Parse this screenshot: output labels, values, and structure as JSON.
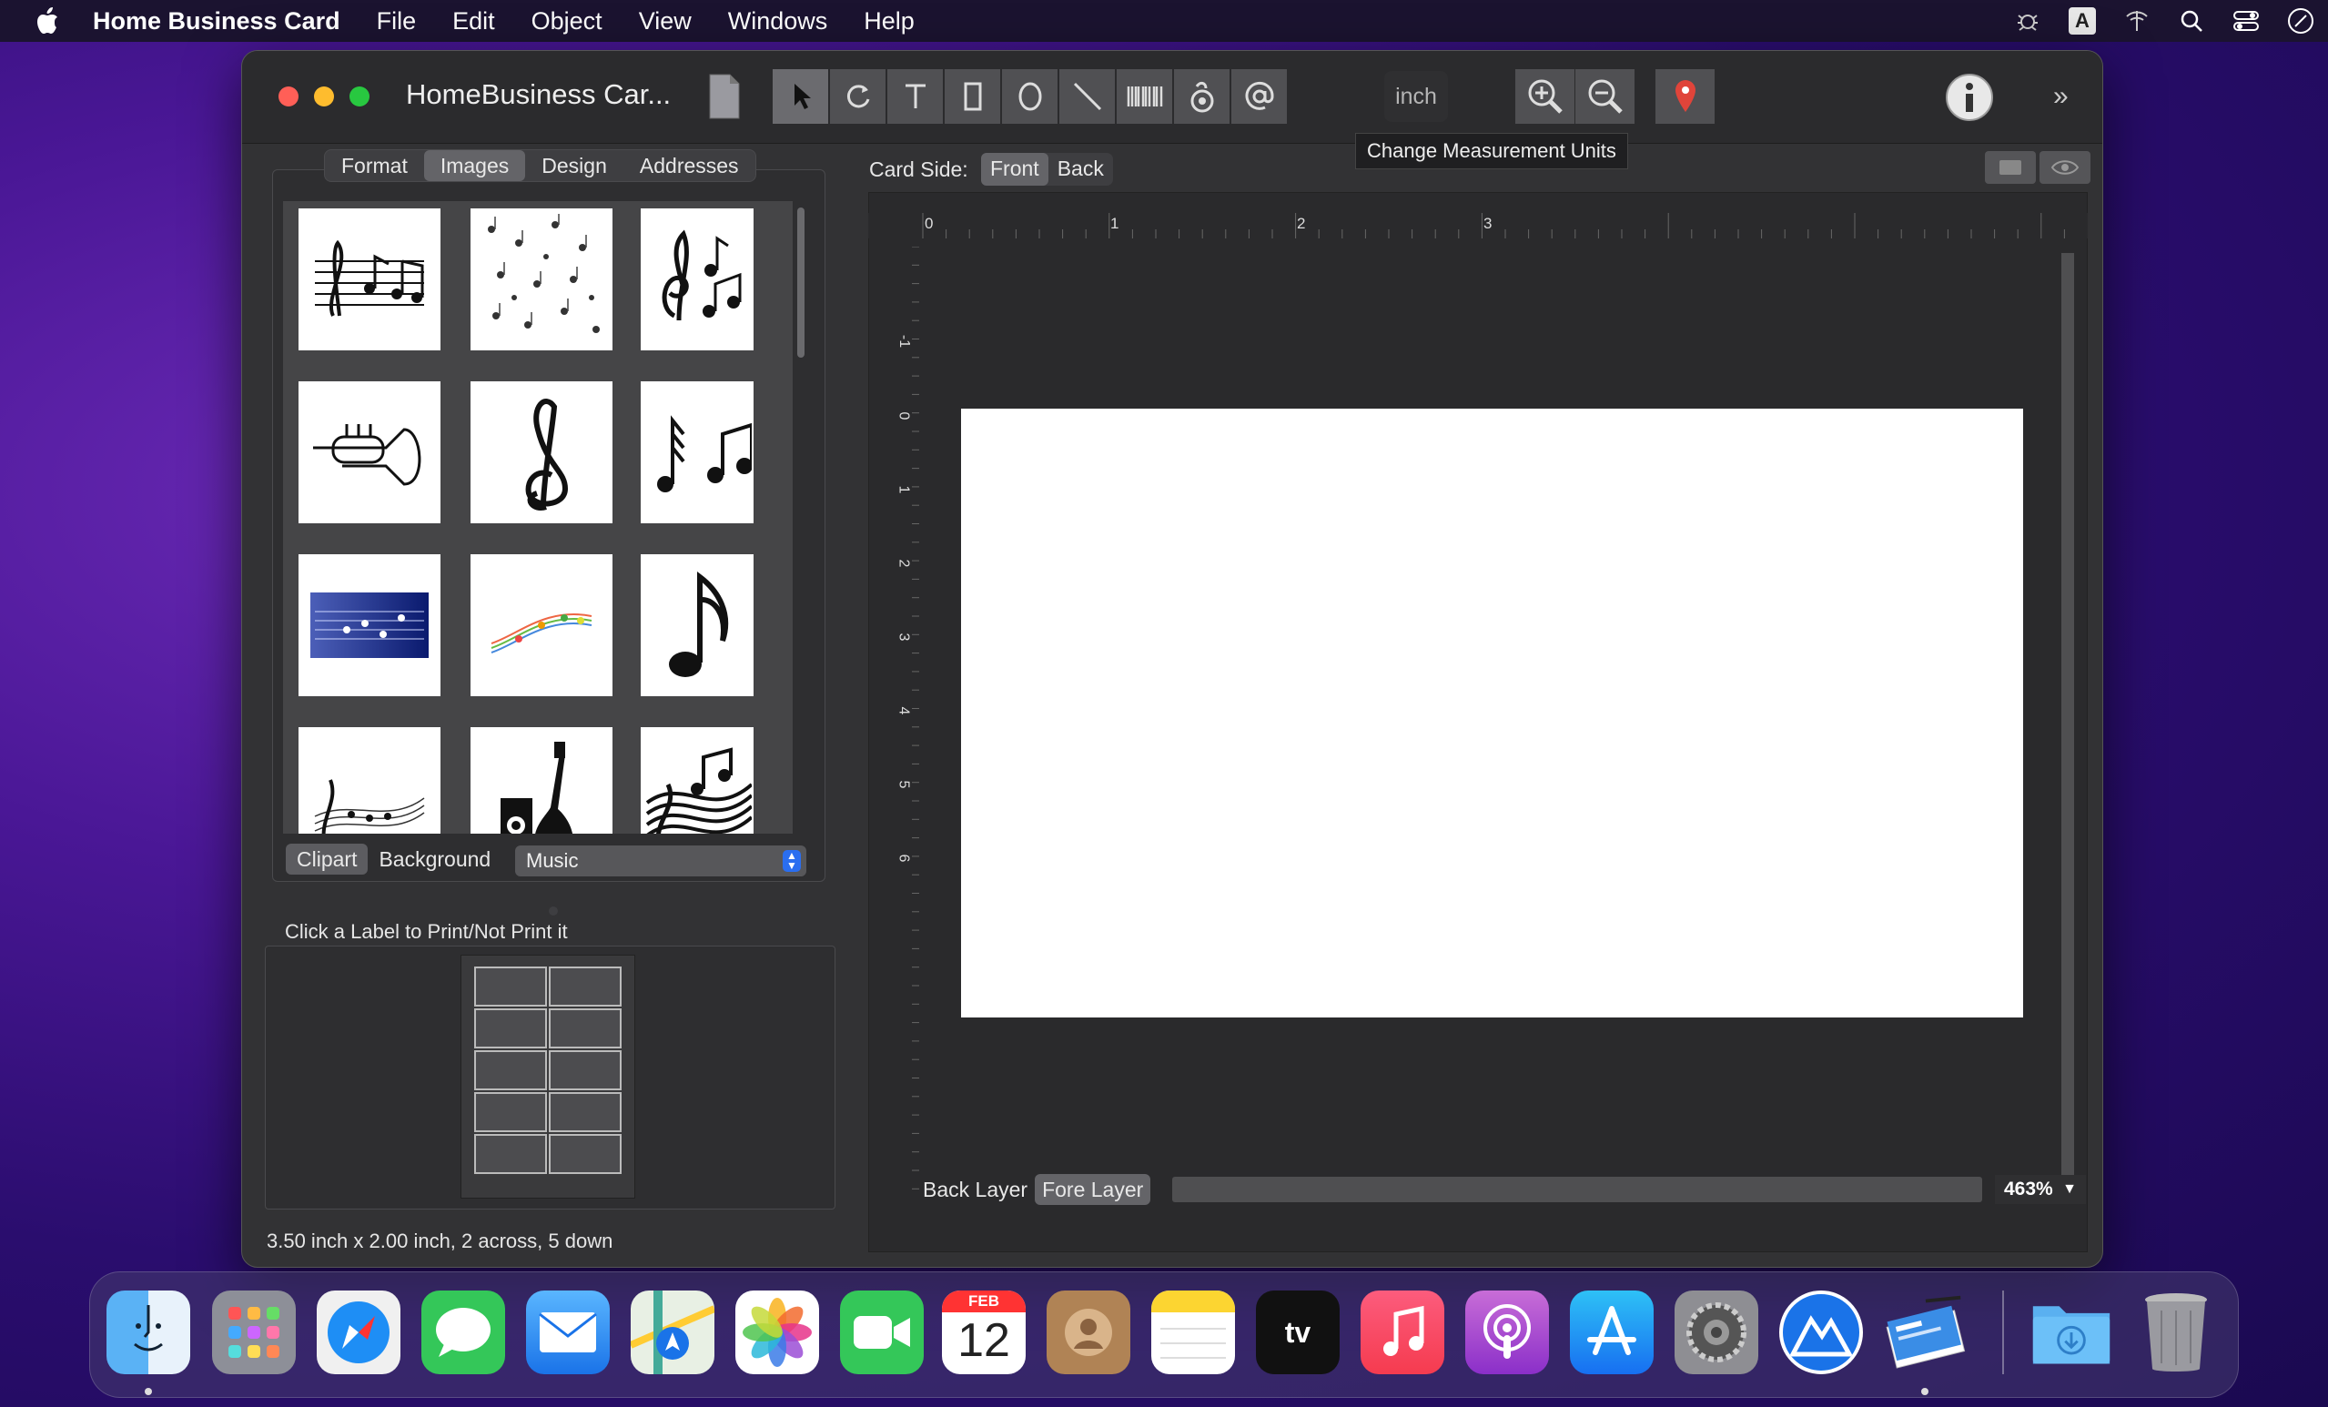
{
  "menubar": {
    "app": "Home Business Card",
    "items": [
      "File",
      "Edit",
      "Object",
      "View",
      "Windows",
      "Help"
    ]
  },
  "window": {
    "title": "HomeBusiness Car...",
    "unit": "inch",
    "tooltip": "Change Measurement Units"
  },
  "left": {
    "tabs": [
      "Format",
      "Images",
      "Design",
      "Addresses"
    ],
    "active_tab": "Images",
    "bottom_tabs": [
      "Clipart",
      "Background"
    ],
    "category": "Music",
    "label_hint": "Click a Label to Print/Not Print it",
    "status": "3.50 inch x 2.00 inch, 2 across, 5 down"
  },
  "right": {
    "card_side_label": "Card Side:",
    "sides": [
      "Front",
      "Back"
    ],
    "layers": [
      "Back Layer",
      "Fore Layer"
    ],
    "zoom": "463%",
    "hticks": [
      "0",
      "1",
      "2",
      "3"
    ],
    "vticks": [
      "-1",
      "0",
      "1",
      "2",
      "3",
      "4",
      "5",
      "6"
    ]
  },
  "dock": {
    "calendar_month": "FEB",
    "calendar_day": "12",
    "tv_label": "tv"
  },
  "colors": {
    "accent": "#2a6ef0",
    "close": "#ff5f57",
    "minimize": "#febc2e",
    "zoom": "#28c840"
  }
}
